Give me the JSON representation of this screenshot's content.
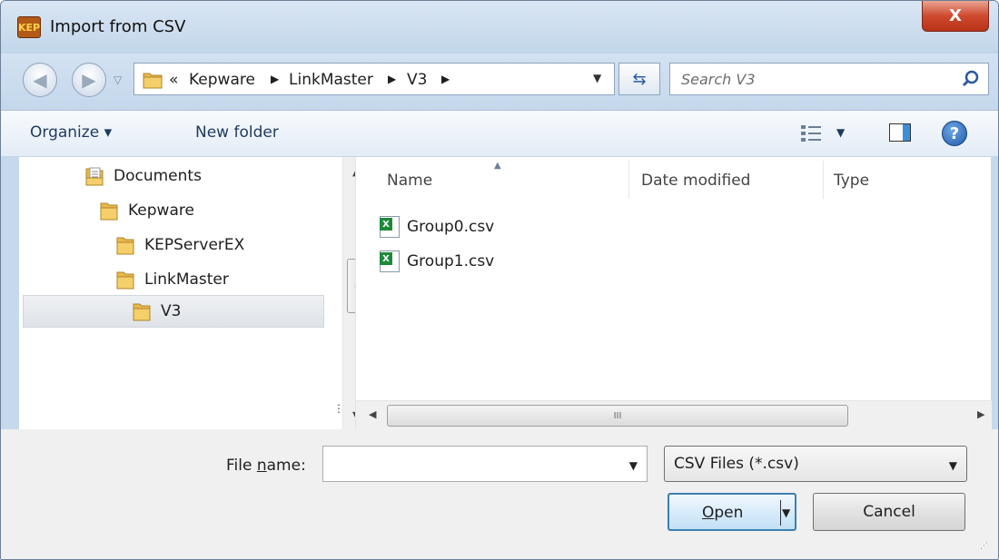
{
  "window": {
    "title": "Import from CSV",
    "close_label": "X",
    "app_icon_text": "KEP"
  },
  "nav": {
    "back_icon": "back-arrow-icon",
    "forward_icon": "forward-arrow-icon",
    "breadcrumb_prefix": "«",
    "breadcrumb": [
      "Kepware",
      "LinkMaster",
      "V3"
    ],
    "refresh_icon": "refresh-icon"
  },
  "search": {
    "placeholder": "Search V3"
  },
  "toolbar": {
    "organize_label": "Organize ▾",
    "new_folder_label": "New folder",
    "help_label": "?"
  },
  "tree": {
    "items": [
      {
        "label": "Documents",
        "icon": "documents-icon"
      },
      {
        "label": "Kepware",
        "icon": "folder-icon"
      },
      {
        "label": "KEPServerEX",
        "icon": "folder-icon"
      },
      {
        "label": "LinkMaster",
        "icon": "folder-icon"
      },
      {
        "label": "V3",
        "icon": "folder-icon",
        "selected": true
      }
    ]
  },
  "files": {
    "columns": [
      "Name",
      "Date modified",
      "Type"
    ],
    "rows": [
      {
        "name": "Group0.csv",
        "icon": "csv-file-icon"
      },
      {
        "name": "Group1.csv",
        "icon": "csv-file-icon"
      }
    ],
    "scroll_grip": "III"
  },
  "footer": {
    "file_name_label_pre": "File ",
    "file_name_label_u": "n",
    "file_name_label_post": "ame:",
    "file_name_value": "",
    "filter_value": "CSV Files (*.csv)",
    "open_label_u": "O",
    "open_label_rest": "pen",
    "cancel_label": "Cancel"
  }
}
